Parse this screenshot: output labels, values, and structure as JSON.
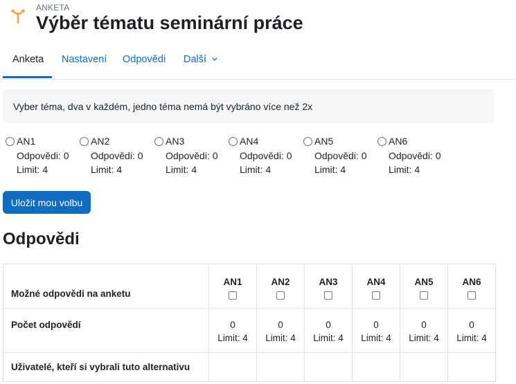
{
  "header": {
    "kicker": "ANKETA",
    "title": "Výběr tématu seminární práce",
    "logo_icon": "choice-signpost-icon",
    "logo_color": "#f0a137"
  },
  "tabs": [
    {
      "label": "Anketa",
      "active": true
    },
    {
      "label": "Nastavení",
      "active": false
    },
    {
      "label": "Odpovědi",
      "active": false
    },
    {
      "label": "Další",
      "active": false
    }
  ],
  "intro": "Vyber téma, dva v každém, jedno téma nemá být vybráno více než 2x",
  "options": [
    {
      "label": "AN1",
      "responses": "Odpovědi: 0",
      "limit": "Limit: 4"
    },
    {
      "label": "AN2",
      "responses": "Odpovědi: 0",
      "limit": "Limit: 4"
    },
    {
      "label": "AN3",
      "responses": "Odpovědi: 0",
      "limit": "Limit: 4"
    },
    {
      "label": "AN4",
      "responses": "Odpovědi: 0",
      "limit": "Limit: 4"
    },
    {
      "label": "AN5",
      "responses": "Odpovědi: 0",
      "limit": "Limit: 4"
    },
    {
      "label": "AN6",
      "responses": "Odpovědi: 0",
      "limit": "Limit: 4"
    }
  ],
  "save_label": "Uložit mou volbu",
  "results": {
    "title": "Odpovědi",
    "row_options": "Možné odpovědi na anketu",
    "row_count": "Počet odpovědí",
    "row_users": "Uživatelé, kteří si vybrali tuto alternativu",
    "columns": [
      {
        "label": "AN1",
        "count": "0",
        "limit": "Limit: 4"
      },
      {
        "label": "AN2",
        "count": "0",
        "limit": "Limit: 4"
      },
      {
        "label": "AN3",
        "count": "0",
        "limit": "Limit: 4"
      },
      {
        "label": "AN4",
        "count": "0",
        "limit": "Limit: 4"
      },
      {
        "label": "AN5",
        "count": "0",
        "limit": "Limit: 4"
      },
      {
        "label": "AN6",
        "count": "0",
        "limit": "Limit: 4"
      }
    ]
  },
  "colors": {
    "accent": "#0f6cbf",
    "text": "#1d2125",
    "muted": "#6a737b"
  }
}
